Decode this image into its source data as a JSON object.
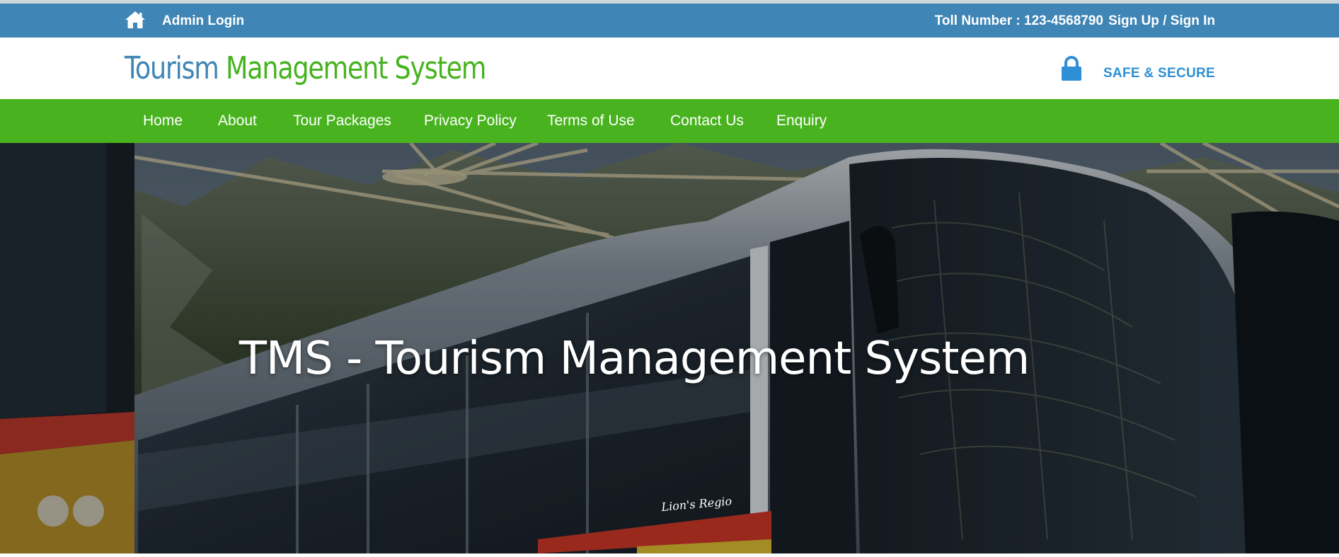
{
  "topbar": {
    "admin_login": "Admin Login",
    "toll": "Toll Number : 123-4568790",
    "signup": "Sign Up / Sign In",
    "home_icon": "home-icon",
    "background_color": "#3f85b5"
  },
  "header": {
    "brand_part1": "Tourism",
    "brand_part2": "Management System",
    "secure_label": "SAFE & SECURE",
    "lock_icon": "lock-icon",
    "brand_color_1": "#3f85b5",
    "brand_color_2": "#46b31f"
  },
  "nav": {
    "background_color": "#49b31f",
    "items": [
      {
        "label": "Home"
      },
      {
        "label": "About"
      },
      {
        "label": "Tour Packages"
      },
      {
        "label": "Privacy Policy"
      },
      {
        "label": "Terms of Use"
      },
      {
        "label": "Contact Us"
      },
      {
        "label": "Enquiry"
      }
    ]
  },
  "hero": {
    "title": "TMS - Tourism Management System",
    "bus_text": "Lion's Regio"
  }
}
